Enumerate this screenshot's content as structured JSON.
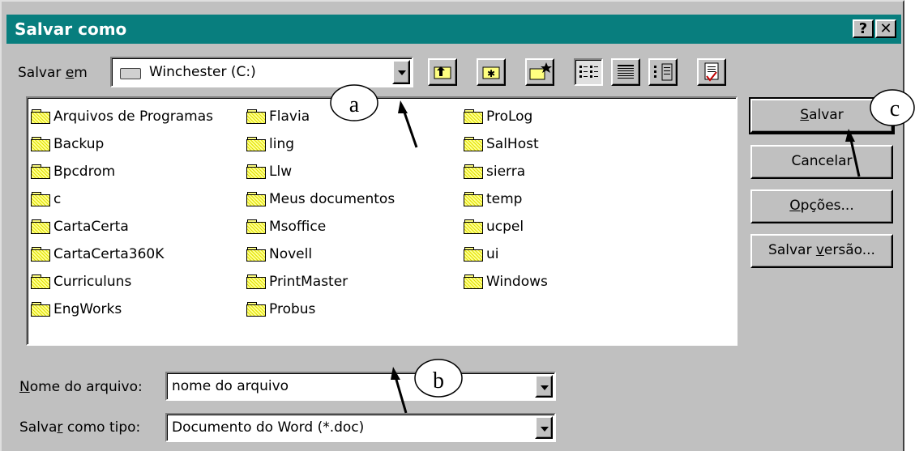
{
  "window": {
    "title": "Salvar como",
    "help_glyph": "?",
    "close_glyph": "✕"
  },
  "save_in": {
    "label": "Salvar em",
    "value": "Winchester (C:)",
    "drive_icon": "hard-drive-icon"
  },
  "toolbar": {
    "icons": [
      "up-one-level-icon",
      "favorites-icon",
      "new-folder-icon",
      "list-view-icon",
      "details-view-icon",
      "properties-view-icon",
      "commands-icon"
    ]
  },
  "folders": [
    "Arquivos de Programas",
    "Backup",
    "Bpcdrom",
    "c",
    "CartaCerta",
    "CartaCerta360K",
    "Curriculuns",
    "EngWorks",
    "Flavia",
    "ling",
    "Llw",
    "Meus documentos",
    "Msoffice",
    "Novell",
    "PrintMaster",
    "Probus",
    "ProLog",
    "SalHost",
    "sierra",
    "temp",
    "ucpel",
    "ui",
    "Windows"
  ],
  "file_name": {
    "label": "Nome do arquivo:",
    "value": "nome do arquivo"
  },
  "file_type": {
    "label": "Salvar como tipo:",
    "value": "Documento do Word (*.doc)"
  },
  "buttons": {
    "save": "Salvar",
    "cancel": "Cancelar",
    "options": "Opções...",
    "save_version": "Salvar versão..."
  },
  "annotations": {
    "a": "a",
    "b": "b",
    "c": "c"
  }
}
